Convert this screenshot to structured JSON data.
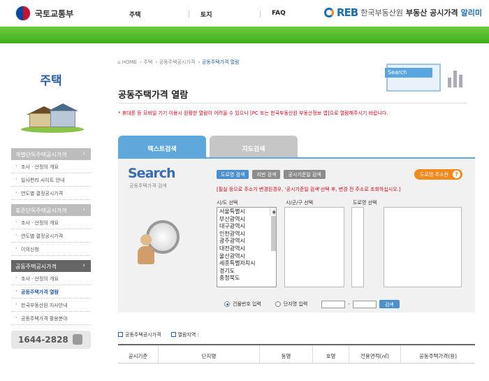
{
  "header": {
    "ministry": "국토교통부",
    "nav": [
      "주택",
      "토지",
      "FAQ"
    ],
    "brand": {
      "reb": "REB",
      "org": "한국부동산원",
      "service": "부동산 공시가격",
      "alimi": "알리미"
    }
  },
  "sidebar": {
    "title": "주택",
    "groups": [
      {
        "label": "개별단독주택공시가격",
        "active": false,
        "items": [
          "조사 · 산정의 개요",
          "일사편리 사이트 안내",
          "연도별 결정공시가격"
        ]
      },
      {
        "label": "표준단독주택공시가격",
        "active": false,
        "items": [
          "조사 · 산정의 개요",
          "연도별 결정공시가격",
          "이의신청"
        ]
      },
      {
        "label": "공동주택공시가격",
        "active": true,
        "items": [
          "조사 · 산정의 개요",
          "공동주택가격 열람",
          "한국부동산원 지사안내",
          "공동주택가격 활용분야"
        ]
      }
    ],
    "current_item": "공동주택가격 열람",
    "phone": "1644-2828"
  },
  "breadcrumb": {
    "home": "HOME",
    "items": [
      "주택",
      "공동주택공시가격",
      "공동주택가격 열람"
    ]
  },
  "page_title": "공동주택가격 열람",
  "notice": "* 휴대폰 등 모바일 기기 이용시 원활한 열람이 어려울 수 있으니 [PC 또는 한국부동산원 부동산정보 앱]으로 열람해주시기 바랍니다.",
  "deco_search": "Search",
  "tabs": [
    {
      "label": "텍스트검색",
      "active": true
    },
    {
      "label": "지도검색",
      "active": false
    }
  ],
  "search_panel": {
    "title": "Search",
    "subtitle": "공동주택가격 검색",
    "buttons": [
      {
        "label": "도로명 검색",
        "active": true
      },
      {
        "label": "지번 검색",
        "active": false
      },
      {
        "label": "공시기준일 검색",
        "active": false
      }
    ],
    "road_help": "도로명 주소란",
    "help_q": "?",
    "warning": "[필실 등으로 주소가 변경된경우, '공시기준일 검색'선택 후, 변경 전 주소로 조회하십시오.]",
    "sido_label": "시/도 선택",
    "sigungu_label": "시/군/구 선택",
    "road_label": "도로명 선택",
    "sido_options": [
      "서울특별시",
      "부산광역시",
      "대구광역시",
      "인천광역시",
      "광주광역시",
      "대전광역시",
      "울산광역시",
      "세종특별자치시",
      "경기도",
      "충청북도"
    ],
    "radio_building": "건물번호 입력",
    "radio_complex": "단지명 입력",
    "dash": "-",
    "go_button": "검색"
  },
  "results": {
    "label1": "공동주택공시가격",
    "label2": "열람지역 :",
    "columns": [
      "공시기준",
      "단지명",
      "동명",
      "호명",
      "전용면적(㎡)",
      "공동주택가격(원)"
    ]
  },
  "colors": {
    "accent": "#5fa8dc",
    "green_band": "#4cbb28",
    "warning": "#d0021b",
    "orange": "#f08a1c",
    "brand_blue": "#1b6fb5"
  }
}
